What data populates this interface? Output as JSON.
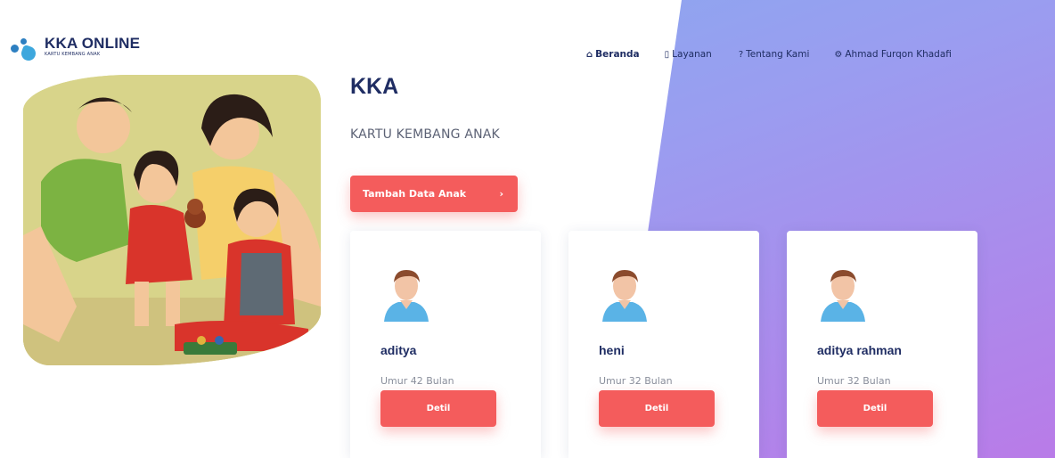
{
  "brand": {
    "title": "KKA ONLINE",
    "subtitle": "KARTU KEMBANG ANAK"
  },
  "nav": {
    "items": [
      {
        "label": "Beranda",
        "icon": "home-icon",
        "active": true
      },
      {
        "label": "Layanan",
        "icon": "document-icon",
        "active": false
      },
      {
        "label": "Tentang Kami",
        "icon": "question-icon",
        "active": false
      },
      {
        "label": "Ahmad Furqon Khadafi",
        "icon": "gear-icon",
        "active": false
      }
    ]
  },
  "hero": {
    "title": "KKA",
    "subtitle": "KARTU KEMBANG ANAK",
    "add_button": "Tambah Data Anak",
    "add_button_icon": "chevron-right-icon"
  },
  "children": [
    {
      "name": "aditya",
      "age": "Umur 42 Bulan",
      "detail_label": "Detil"
    },
    {
      "name": "heni",
      "age": "Umur 32 Bulan",
      "detail_label": "Detil"
    },
    {
      "name": "aditya rahman",
      "age": "Umur 32 Bulan",
      "detail_label": "Detil"
    }
  ],
  "colors": {
    "accent": "#f45c5c",
    "brand": "#1f2d63",
    "gradient_start": "#7fb0ee",
    "gradient_end": "#b97be8"
  }
}
